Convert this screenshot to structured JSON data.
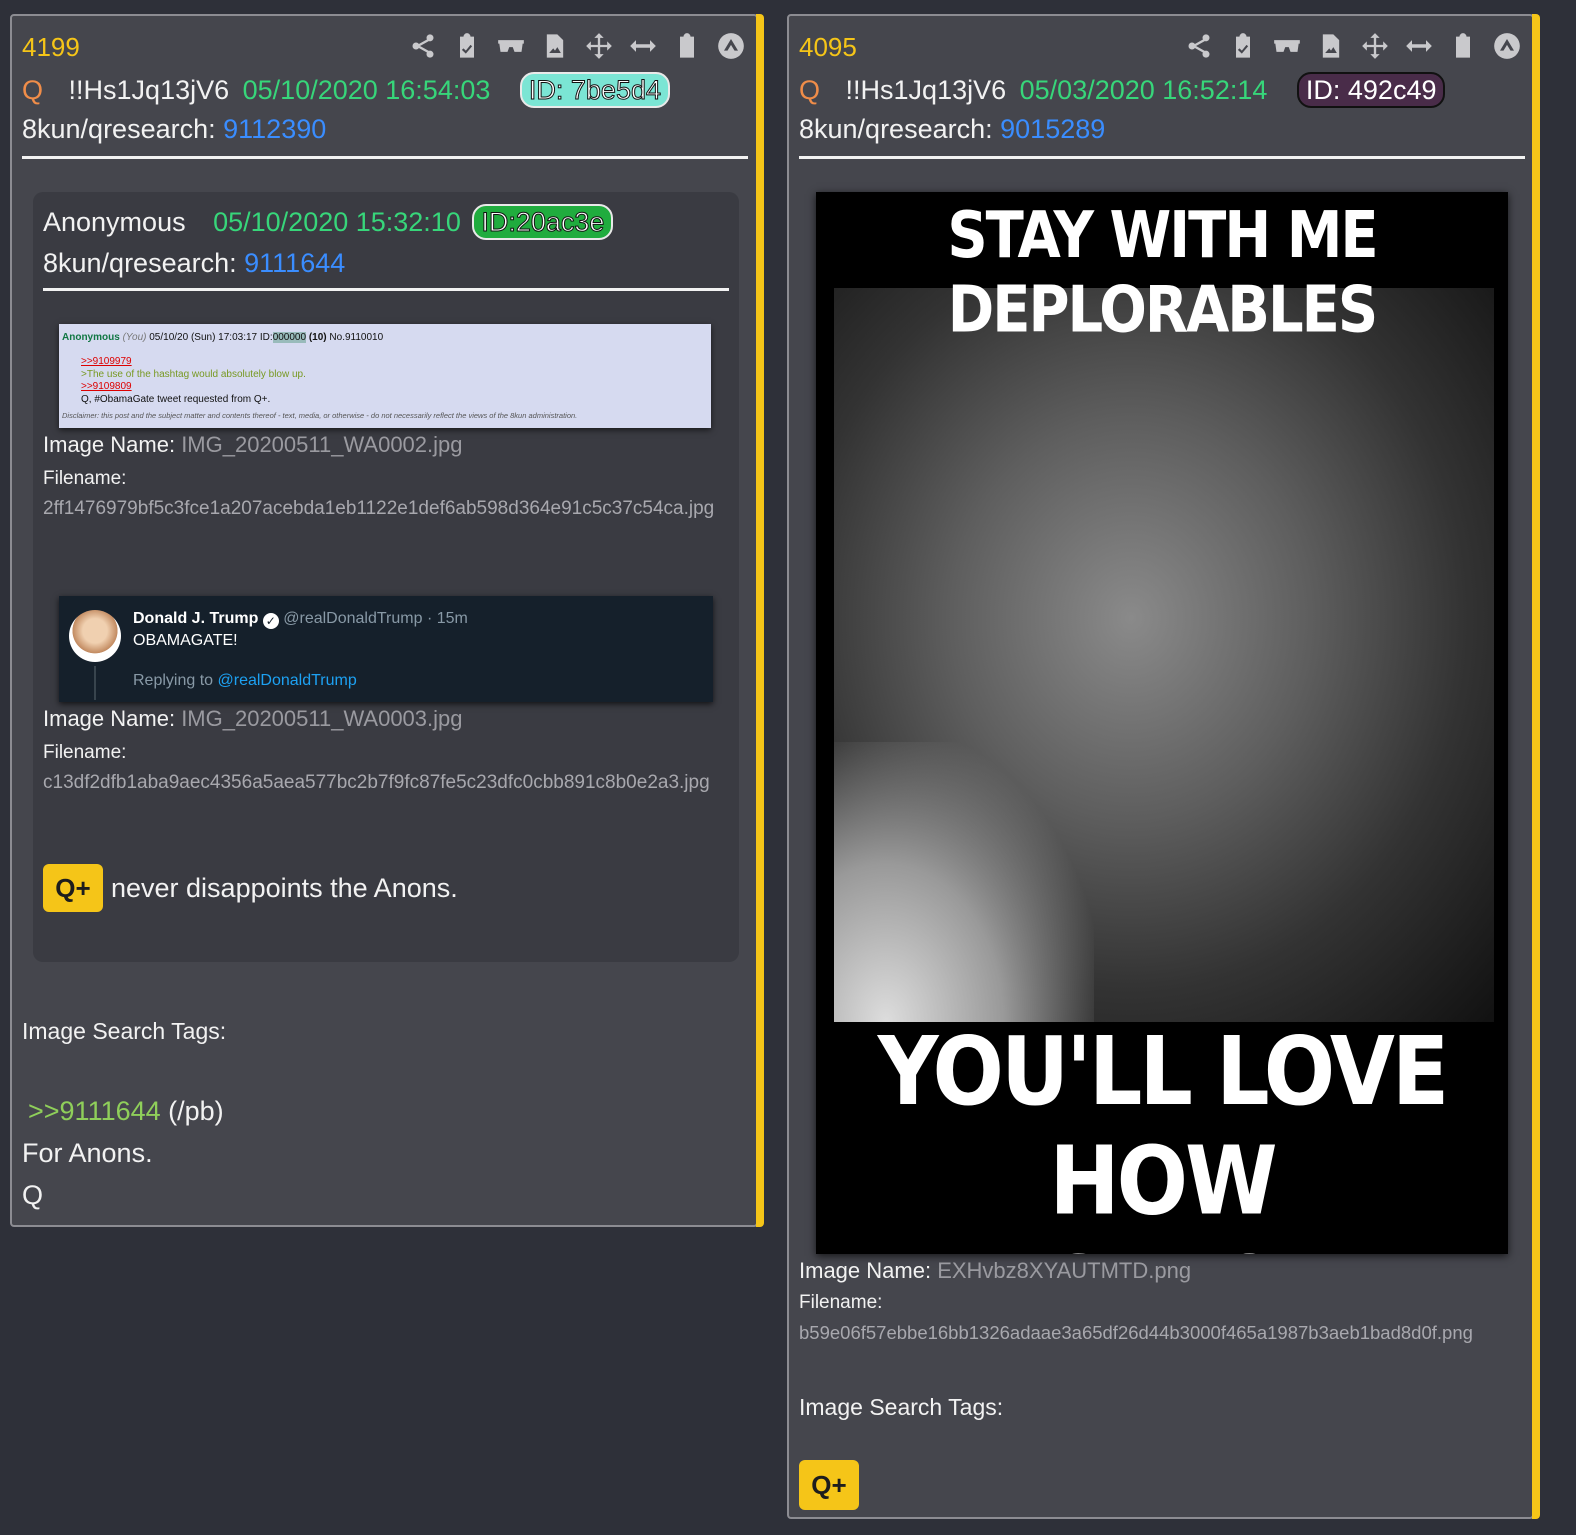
{
  "left_post": {
    "number": "4199",
    "author_q": "Q",
    "tripcode": "!!Hs1Jq13jV6",
    "date": "05/10/2020 16:54:03",
    "id": "ID: 7be5d4",
    "id_color": "#7be5d4",
    "board": "8kun/qresearch:",
    "post_no": "9112390",
    "quoted": {
      "author": "Anonymous",
      "date": "05/10/2020 15:32:10",
      "id": "ID:20ac3e",
      "id_color": "#20ac3e",
      "board": "8kun/qresearch:",
      "post_no": "9111644",
      "image1": {
        "screenshot": {
          "name": "Anonymous",
          "you": "(You)",
          "date": "05/10/20 (Sun) 17:03:17",
          "id_label": "ID:",
          "id": "000000",
          "count": "(10)",
          "no": "No.9110010",
          "line1": ">>9109979",
          "line2": ">The use of the hashtag would absolutely blow up.",
          "line3": ">>9109809",
          "line4": "Q, #ObamaGate tweet requested from Q+.",
          "disclaimer": "Disclaimer: this post and the subject matter and contents thereof - text, media, or otherwise - do not necessarily reflect the views of the 8kun administration."
        },
        "name_label": "Image Name:",
        "name_value": "IMG_20200511_WA0002.jpg",
        "filename_label": "Filename:",
        "filename_value": "2ff1476979bf5c3fce1a207acebda1eb1122e1def6ab598d364e91c5c37c54ca.jpg"
      },
      "image2": {
        "tweet": {
          "name": "Donald J. Trump",
          "handle": "@realDonaldTrump · 15m",
          "text": "OBAMAGATE!",
          "reply_label": "Replying to",
          "reply_handle": "@realDonaldTrump"
        },
        "name_label": "Image Name:",
        "name_value": "IMG_20200511_WA0003.jpg",
        "filename_label": "Filename:",
        "filename_value": "c13df2dfb1aba9aec4356a5aea577bc2b7f9fc87fe5c23dfc0cbb891c8b0e2a3.jpg"
      },
      "badge": "Q+",
      "message": "never disappoints the Anons."
    },
    "tags_label": "Image Search Tags:",
    "reply_link": ">>9111644",
    "reply_suffix": "(/pb)",
    "line_anons": "For Anons.",
    "sign": "Q"
  },
  "right_post": {
    "number": "4095",
    "author_q": "Q",
    "tripcode": "!!Hs1Jq13jV6",
    "date": "05/03/2020 16:52:14",
    "id": "ID: 492c49",
    "id_color": "#492c49",
    "board": "8kun/qresearch:",
    "post_no": "9015289",
    "meme_top": "STAY WITH ME DEPLORABLES",
    "meme_bottom_1": "YOU'LL LOVE HOW",
    "meme_bottom_2": "THIS MOVIE ENDS",
    "name_label": "Image Name:",
    "name_value": "EXHvbz8XYAUTMTD.png",
    "filename_label": "Filename:",
    "filename_value": "b59e06f57ebbe16bb1326adaae3a65df26d44b3000f465a1987b3aeb1bad8d0f.png",
    "tags_label": "Image Search Tags:",
    "badge": "Q+"
  },
  "icons": [
    "share-icon",
    "clipboard-check-icon",
    "glasses-icon",
    "file-image-icon",
    "move-icon",
    "arrows-horizontal-icon",
    "clipboard-icon",
    "arrow-up-circle-icon"
  ],
  "colors": {
    "accent": "#f5c518",
    "date_green": "#37d67a",
    "link_blue": "#3a8dff",
    "q_orange": "#f08d49"
  }
}
